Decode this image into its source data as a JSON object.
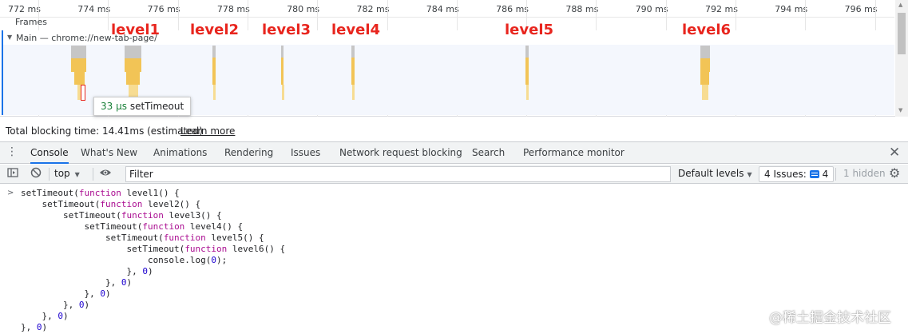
{
  "timeline": {
    "ticks": [
      "772 ms",
      "774 ms",
      "776 ms",
      "778 ms",
      "780 ms",
      "782 ms",
      "784 ms",
      "786 ms",
      "788 ms",
      "790 ms",
      "792 ms",
      "794 ms",
      "796 ms"
    ],
    "frames_label": "Frames",
    "main_track_title": "Main — chrome://new-tab-page/",
    "level_labels": [
      "level1",
      "level2",
      "level3",
      "level4",
      "level5",
      "level6"
    ],
    "tooltip": {
      "duration": "33 μs",
      "name": "setTimeout"
    },
    "colors": {
      "task": "#c6c6c6",
      "script": "#f2c456",
      "script_light": "#f7dc92",
      "selected_outline": "#e8251e",
      "track_bg": "#f4f7fd",
      "track_border": "#1a73e8"
    }
  },
  "summary": {
    "total_blocking_time": "Total blocking time: 14.41ms (estimated)",
    "learn_more": "Learn more"
  },
  "drawer": {
    "menu_icon": "kebab-menu-icon",
    "tabs": [
      {
        "label": "Console",
        "active": true
      },
      {
        "label": "What's New"
      },
      {
        "label": "Animations"
      },
      {
        "label": "Rendering"
      },
      {
        "label": "Issues"
      },
      {
        "label": "Network request blocking"
      },
      {
        "label": "Search"
      },
      {
        "label": "Performance monitor"
      }
    ],
    "close_icon": "close-icon"
  },
  "console_toolbar": {
    "sidebar_icon": "show-sidebar-icon",
    "clear_icon": "clear-console-icon",
    "context": "top",
    "eye_icon": "live-expression-icon",
    "filter_placeholder": "Filter",
    "default_levels": "Default levels",
    "issues_label": "4 Issues:",
    "issues_count": "4",
    "hidden": "1 hidden",
    "settings_icon": "gear-icon"
  },
  "console": {
    "code_lines": [
      [
        {
          "t": "setTimeout("
        },
        {
          "t": "function",
          "c": "kw"
        },
        {
          "t": " level1() {"
        }
      ],
      [
        {
          "t": "    setTimeout("
        },
        {
          "t": "function",
          "c": "kw"
        },
        {
          "t": " level2() {"
        }
      ],
      [
        {
          "t": "        setTimeout("
        },
        {
          "t": "function",
          "c": "kw"
        },
        {
          "t": " level3() {"
        }
      ],
      [
        {
          "t": "            setTimeout("
        },
        {
          "t": "function",
          "c": "kw"
        },
        {
          "t": " level4() {"
        }
      ],
      [
        {
          "t": "                setTimeout("
        },
        {
          "t": "function",
          "c": "kw"
        },
        {
          "t": " level5() {"
        }
      ],
      [
        {
          "t": "                    setTimeout("
        },
        {
          "t": "function",
          "c": "kw"
        },
        {
          "t": " level6() {"
        }
      ],
      [
        {
          "t": "                        console.log("
        },
        {
          "t": "0",
          "c": "num"
        },
        {
          "t": ");"
        }
      ],
      [
        {
          "t": "                    }, "
        },
        {
          "t": "0",
          "c": "num"
        },
        {
          "t": ")"
        }
      ],
      [
        {
          "t": "                }, "
        },
        {
          "t": "0",
          "c": "num"
        },
        {
          "t": ")"
        }
      ],
      [
        {
          "t": "            }, "
        },
        {
          "t": "0",
          "c": "num"
        },
        {
          "t": ")"
        }
      ],
      [
        {
          "t": "        }, "
        },
        {
          "t": "0",
          "c": "num"
        },
        {
          "t": ")"
        }
      ],
      [
        {
          "t": "    }, "
        },
        {
          "t": "0",
          "c": "num"
        },
        {
          "t": ")"
        }
      ],
      [
        {
          "t": "}, "
        },
        {
          "t": "0",
          "c": "num"
        },
        {
          "t": ")"
        }
      ]
    ]
  },
  "watermark": "@稀土掘金技术社区"
}
